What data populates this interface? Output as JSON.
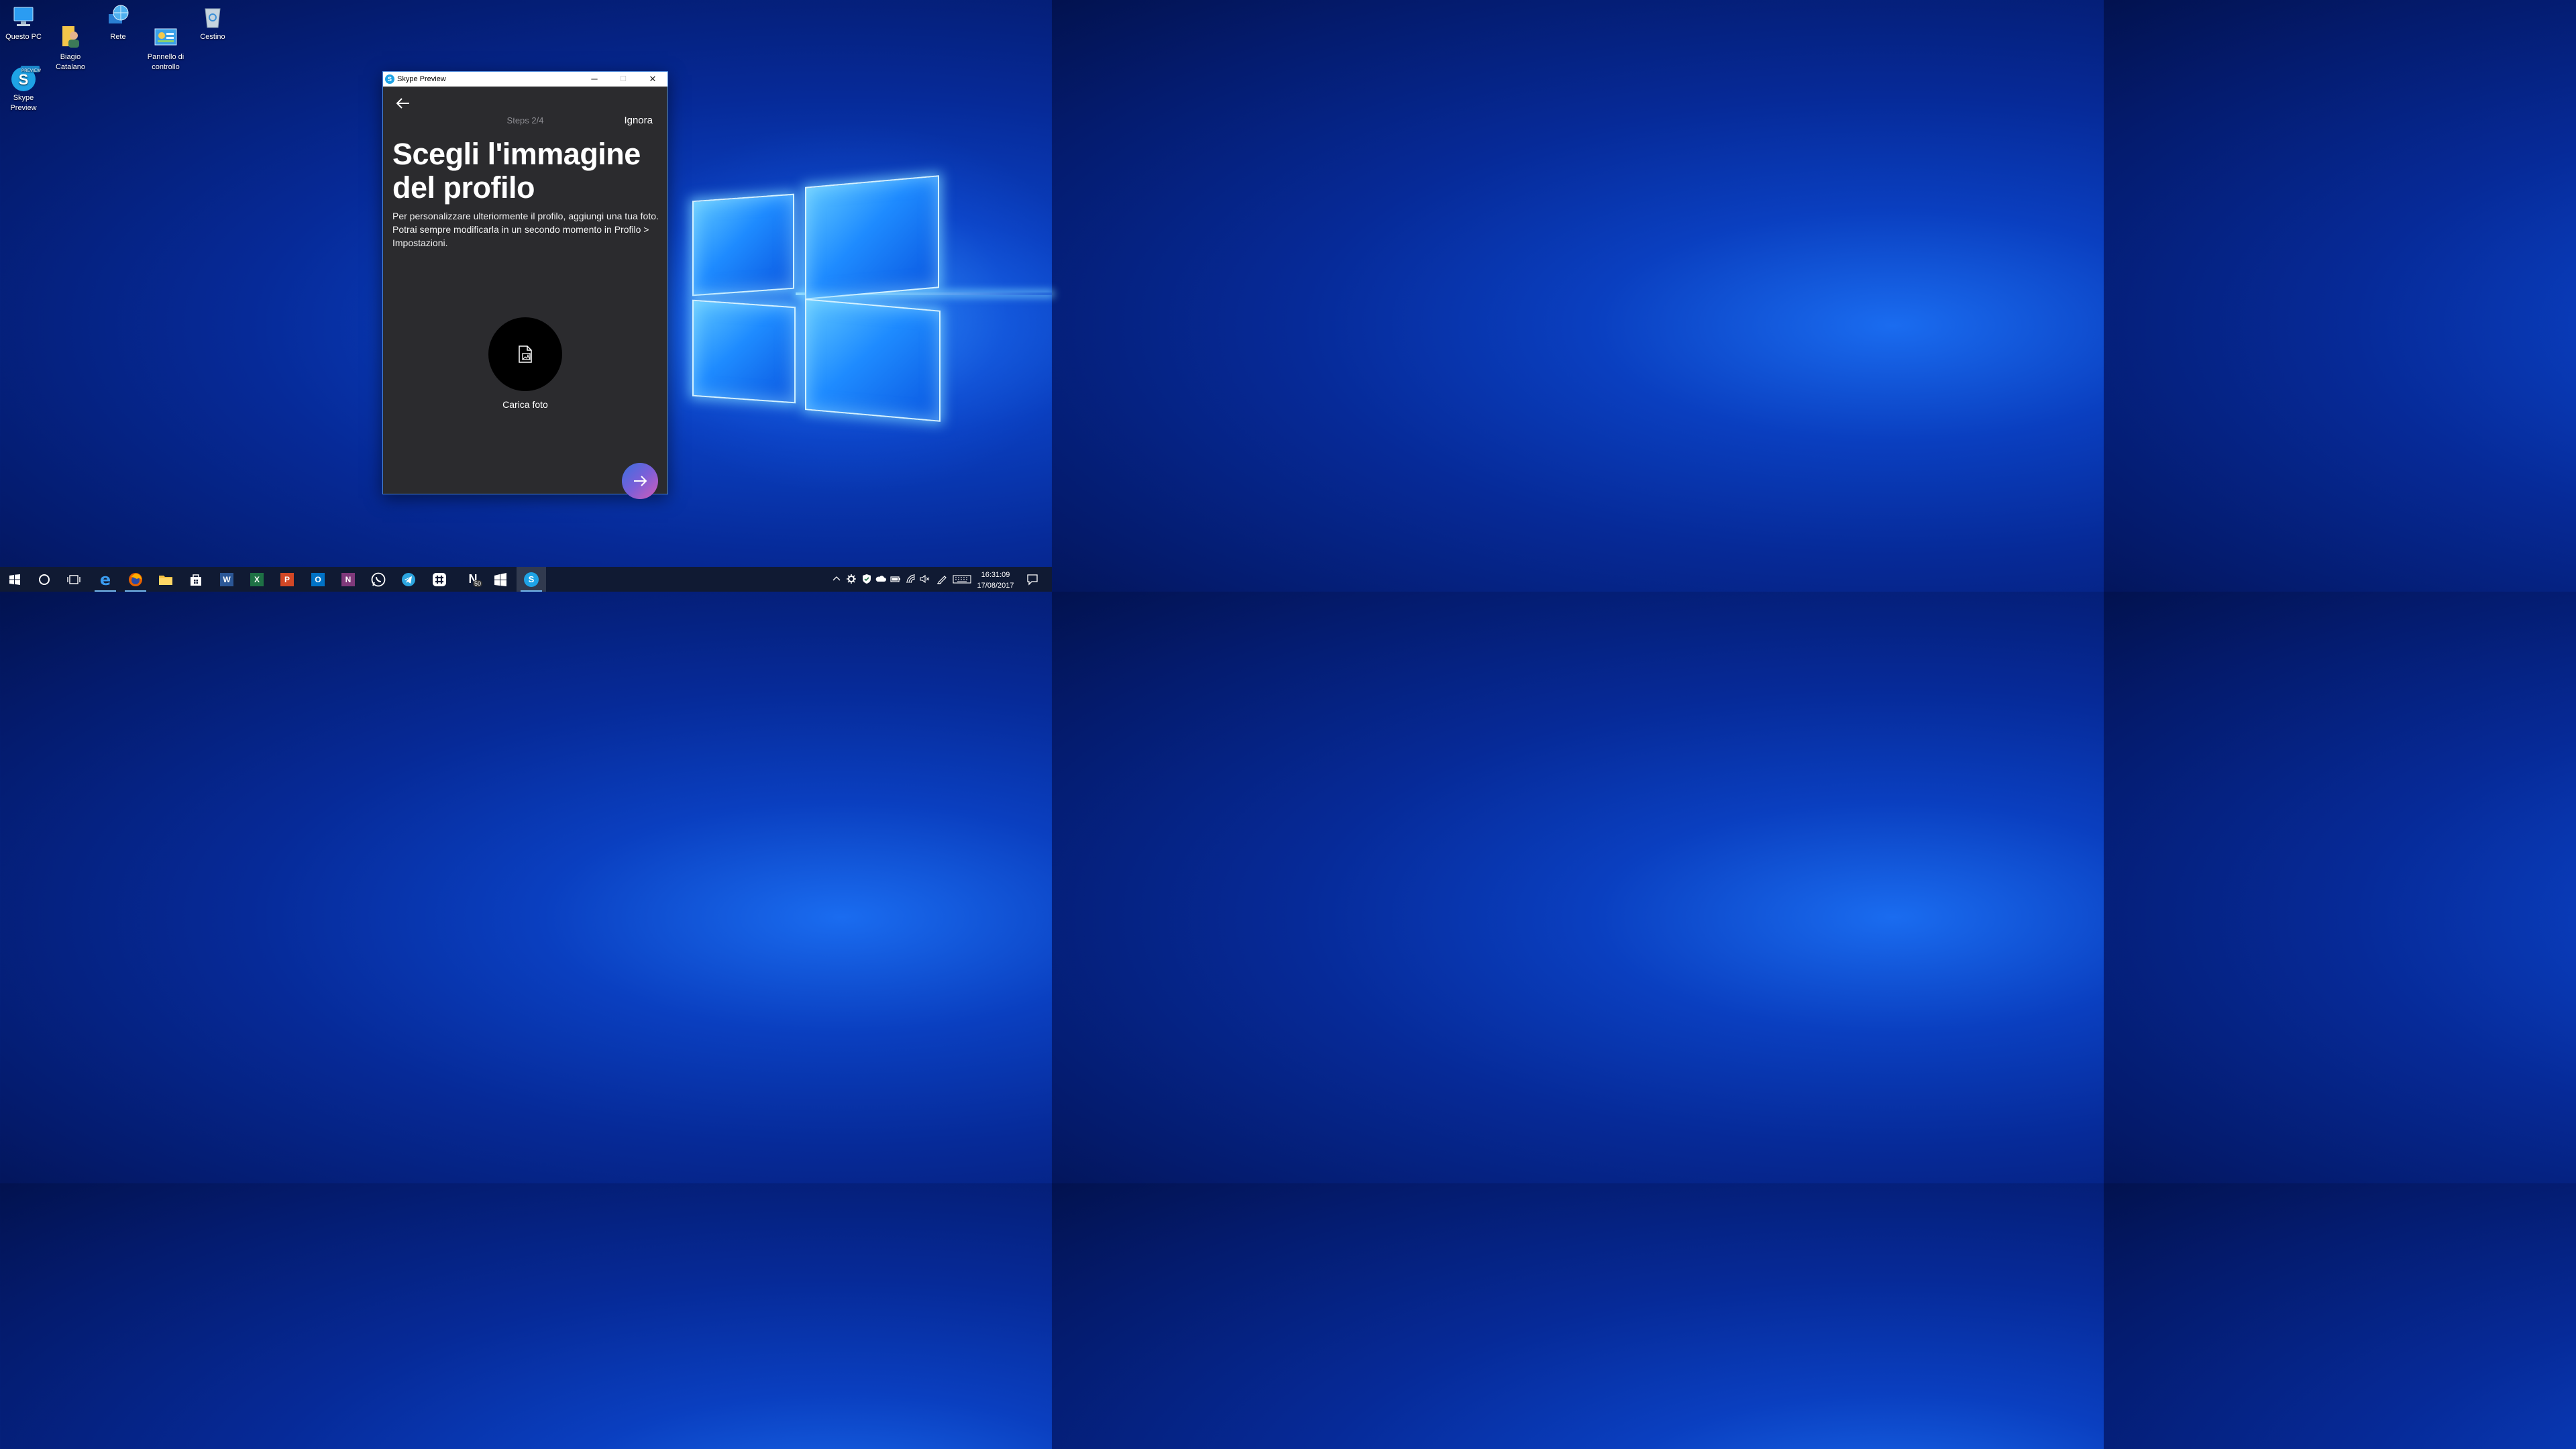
{
  "desktop": {
    "icons": [
      {
        "label": "Questo PC",
        "icon": "computer-icon"
      },
      {
        "label": "Biagio\nCatalano",
        "icon": "user-folder-icon"
      },
      {
        "label": "Rete",
        "icon": "network-globe-icon"
      },
      {
        "label": "Pannello di\ncontrollo",
        "icon": "control-panel-icon"
      },
      {
        "label": "Cestino",
        "icon": "recycle-bin-icon"
      },
      {
        "label": "Skype Preview",
        "icon": "skype-preview-icon"
      }
    ],
    "skype_badge": "PREVIEW"
  },
  "window": {
    "title": "Skype Preview",
    "app_icon_letter": "S",
    "controls": {
      "minimize": "─",
      "maximize": "☐",
      "close": "✕"
    }
  },
  "onboarding": {
    "steps": "Steps 2/4",
    "skip_label": "Ignora",
    "headline_line1": "Scegli l'immagine",
    "headline_line2": "del profilo",
    "description": "Per personalizzare ulteriormente il profilo, aggiungi una tua foto. Potrai sempre modificarla in un secondo momento in Profilo > Impostazioni.",
    "upload_label": "Carica foto"
  },
  "taskbar": {
    "apps": [
      {
        "name": "start",
        "icon": "windows-start-icon"
      },
      {
        "name": "cortana",
        "icon": "cortana-circle-icon"
      },
      {
        "name": "task-view",
        "icon": "task-view-icon"
      },
      {
        "name": "edge",
        "icon": "edge-icon",
        "glyph": "e"
      },
      {
        "name": "firefox",
        "icon": "firefox-icon"
      },
      {
        "name": "file-explorer",
        "icon": "folder-icon"
      },
      {
        "name": "store",
        "icon": "store-icon"
      },
      {
        "name": "word",
        "icon": "word-icon",
        "glyph": "W"
      },
      {
        "name": "excel",
        "icon": "excel-icon",
        "glyph": "X"
      },
      {
        "name": "powerpoint",
        "icon": "powerpoint-icon",
        "glyph": "P"
      },
      {
        "name": "outlook",
        "icon": "outlook-icon",
        "glyph": "O"
      },
      {
        "name": "onenote",
        "icon": "onenote-icon",
        "glyph": "N"
      },
      {
        "name": "whatsapp",
        "icon": "whatsapp-icon"
      },
      {
        "name": "telegram",
        "icon": "telegram-icon"
      },
      {
        "name": "slack",
        "icon": "slack-icon"
      },
      {
        "name": "news",
        "icon": "news-icon",
        "glyph": "N",
        "badge": "50"
      },
      {
        "name": "tiles",
        "icon": "tiles-icon"
      },
      {
        "name": "skype",
        "icon": "skype-icon",
        "glyph": "S"
      }
    ],
    "tray": [
      "chevron-up-icon",
      "gear-icon",
      "shield-icon",
      "onedrive-icon",
      "battery-icon",
      "wifi-icon",
      "volume-muted-icon",
      "pen-icon",
      "keyboard-icon"
    ],
    "time": "16:31:09",
    "date": "17/08/2017",
    "colors": {
      "taskbar": "#101a33",
      "active_indicator": "#76b9ed"
    }
  }
}
